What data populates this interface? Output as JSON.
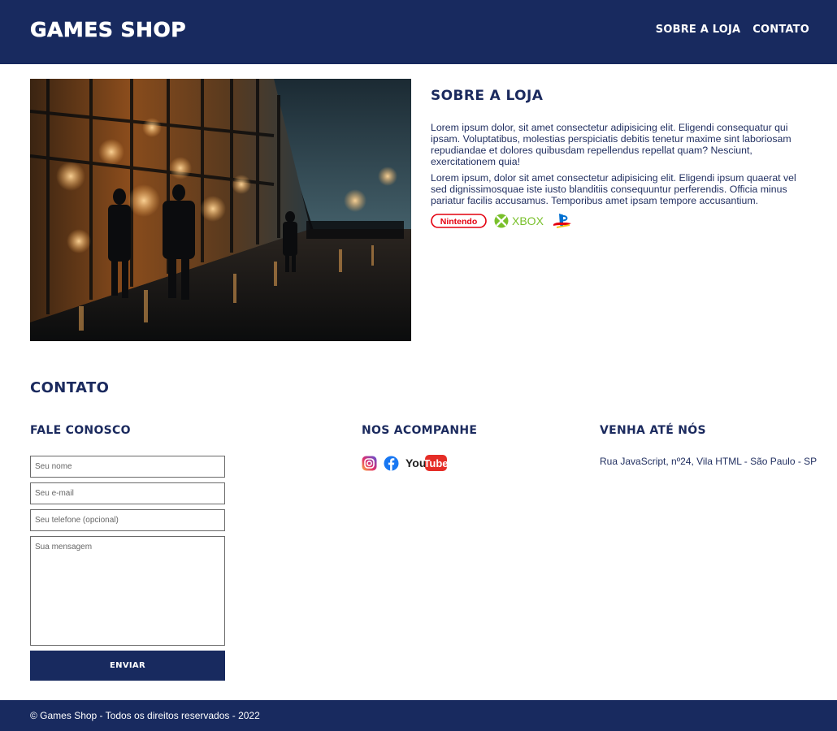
{
  "header": {
    "brand": "GAMES SHOP",
    "nav": [
      "SOBRE A LOJA",
      "CONTATO"
    ],
    "background": "#182a5f"
  },
  "about": {
    "title": "SOBRE A LOJA",
    "paragraphs": [
      "Lorem ipsum dolor, sit amet consectetur adipisicing elit. Eligendi consequatur qui ipsam. Voluptatibus, molestias perspiciatis debitis tenetur maxime sint laboriosam repudiandae et dolores quibusdam repellendus repellat quam? Nesciunt, exercitationem quia!",
      "Lorem ipsum, dolor sit amet consectetur adipisicing elit. Eligendi ipsum quaerat vel sed dignissimosquae iste iusto blanditiis consequuntur perferendis. Officia minus pariatur facilis accusamus. Temporibus amet ipsam tempore accusantium."
    ],
    "brand_logos": [
      "nintendo-logo",
      "xbox-logo",
      "playstation-logo"
    ],
    "xbox_text": "XBOX",
    "nintendo_text": "Nintendo"
  },
  "contact": {
    "title": "CONTATO",
    "columns": {
      "form_title": "FALE CONOSCO",
      "social_title": "NOS ACOMPANHE",
      "address_title": "VENHA ATÉ NÓS"
    },
    "form": {
      "name_placeholder": "Seu nome",
      "email_placeholder": "Seu e-mail",
      "phone_placeholder": "Seu telefone (opcional)",
      "message_placeholder": "Sua mensagem",
      "submit_label": "ENVIAR"
    },
    "social_icons": [
      "instagram-icon",
      "facebook-icon",
      "youtube-icon"
    ],
    "youtube_text": "You",
    "youtube_tube": "Tube",
    "address": "Rua JavaScript, nº24, Vila HTML - São Paulo - SP"
  },
  "footer": {
    "copyright": "© Games Shop - Todos os direitos reservados - 2022"
  }
}
